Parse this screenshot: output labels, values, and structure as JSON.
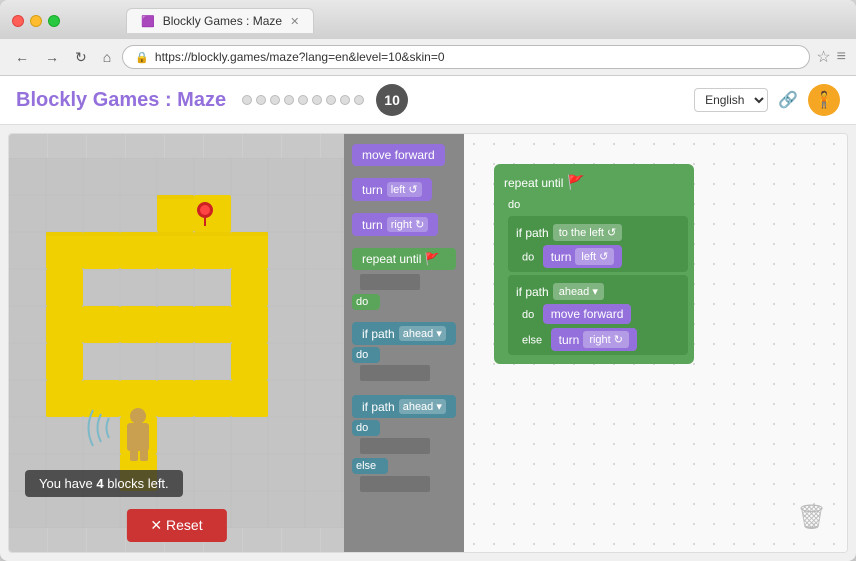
{
  "browser": {
    "tab_title": "Blockly Games : Maze",
    "url": "https://blockly.games/maze?lang=en&level=10&skin=0",
    "nav_back": "←",
    "nav_forward": "→",
    "nav_refresh": "↻",
    "nav_home": "⌂",
    "bookmark_icon": "☆",
    "menu_icon": "≡"
  },
  "app": {
    "title": "Blockly Games : Maze",
    "level_number": "10",
    "lang_label": "English",
    "total_dots": 9
  },
  "maze": {
    "blocks_left_label": "You have",
    "blocks_left_count": "4",
    "blocks_left_suffix": "blocks left.",
    "reset_label": "✕ Reset"
  },
  "toolbox": {
    "blocks": [
      {
        "label": "move forward",
        "type": "purple"
      },
      {
        "label": "turn left",
        "type": "purple",
        "has_dropdown": true
      },
      {
        "label": "turn right",
        "type": "purple",
        "has_dropdown": true
      },
      {
        "label": "repeat until",
        "type": "green",
        "has_goal": true
      },
      {
        "label": "if path",
        "type": "teal",
        "dropdown": "ahead"
      },
      {
        "label": "if path",
        "type": "teal",
        "dropdown": "ahead",
        "has_else": true
      }
    ]
  },
  "workspace": {
    "repeat_block": {
      "label": "repeat until",
      "goal_icon": "🚩",
      "do_label": "do",
      "inner_blocks": [
        {
          "type": "if_path",
          "label": "if path",
          "dropdown": "to the left",
          "do_label": "do",
          "action_label": "turn left"
        },
        {
          "type": "if_path",
          "label": "if path",
          "dropdown": "ahead",
          "do_label": "do",
          "action_label": "move forward",
          "else_label": "else",
          "else_action": "turn right"
        }
      ]
    },
    "trash_icon": "🗑"
  }
}
